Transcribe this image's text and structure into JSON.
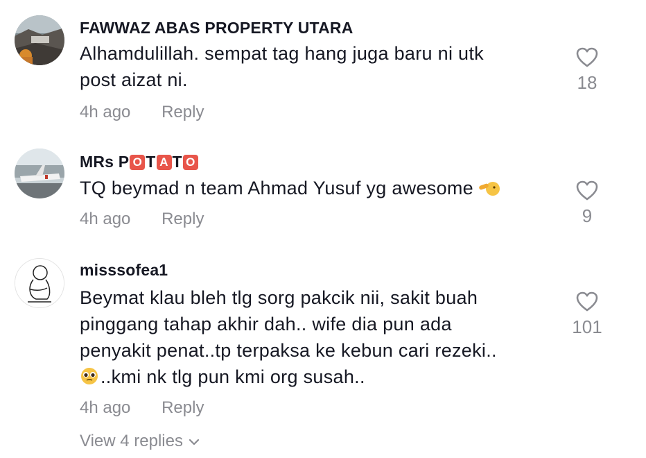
{
  "comments": [
    {
      "username": "FAWWAZ ABAS PROPERTY UTARA",
      "text_lines": [
        "Alhamdulillah. sempat tag hang juga baru ni utk",
        "post aizat ni."
      ],
      "time": "4h ago",
      "reply_label": "Reply",
      "likes": "18",
      "avatar_icon": "outdoor-photo-avatar"
    },
    {
      "username_prefix": "MRs P",
      "username_badges": [
        "O",
        "T",
        "A",
        "T",
        "O"
      ],
      "text": "TQ beymad n team Ahmad Yusuf yg awesome",
      "trailing_emoji": "saluting-hand-emoji",
      "time": "4h ago",
      "reply_label": "Reply",
      "likes": "9",
      "avatar_icon": "airport-photo-avatar"
    },
    {
      "username": "misssofea1",
      "text_lines": [
        "Beymat klau bleh tlg sorg pakcik nii, sakit buah",
        "pinggang tahap akhir dah.. wife dia pun ada",
        "penyakit penat..tp terpaksa ke kebun cari rezeki..",
        "..kmi nk tlg pun kmi org susah.."
      ],
      "leading_emoji_line4": "pleading-face-emoji",
      "time": "4h ago",
      "reply_label": "Reply",
      "likes": "101",
      "avatar_icon": "sketch-figure-avatar"
    }
  ],
  "view_replies_label": "View 4 replies",
  "colors": {
    "text": "#161823",
    "muted": "#8a8b91",
    "badge": "#e8554a"
  }
}
